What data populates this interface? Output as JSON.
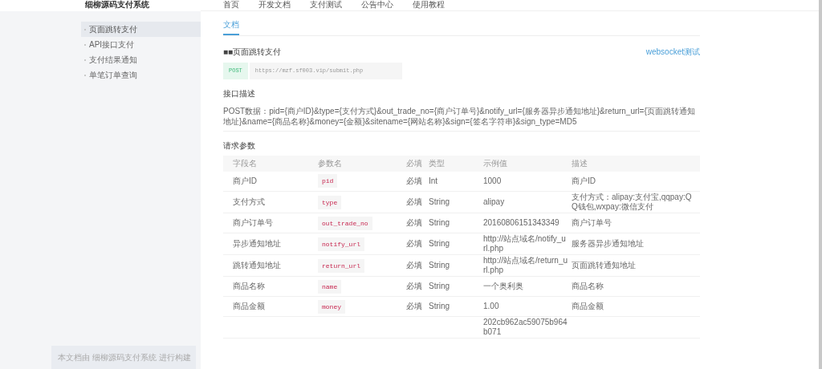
{
  "header": {
    "site_title": "细柳源码支付系统",
    "nav": [
      {
        "label": "首页"
      },
      {
        "label": "开发文档"
      },
      {
        "label": "支付测试"
      },
      {
        "label": "公告中心"
      },
      {
        "label": "使用教程"
      }
    ]
  },
  "sidebar": {
    "items": [
      {
        "label": "页面跳转支付",
        "selected": true
      },
      {
        "label": "API接口支付",
        "selected": false
      },
      {
        "label": "支付结果通知",
        "selected": false
      },
      {
        "label": "单笔订单查询",
        "selected": false
      }
    ],
    "footer": "本文档由 细柳源码支付系统 进行构建"
  },
  "tabs": [
    {
      "label": "文档",
      "selected": true
    }
  ],
  "section_title": "页面跳转支付",
  "section_prefix": "■■",
  "link": "websocket测试",
  "endpoint": {
    "method": "POST",
    "url": "https://mzf.sf003.vip/submit.php"
  },
  "description_title": "接口描述",
  "description": "POST数据：pid={商户ID}&type={支付方式}&out_trade_no={商户订单号}&notify_url={服务器异步通知地址}&return_url={页面跳转通知地址}&name={商品名称}&money={金额}&sitename={网站名称}&sign={签名字符串}&sign_type=MD5",
  "params_title": "请求参数",
  "table": {
    "columns": [
      "字段名",
      "参数名",
      "必填",
      "类型",
      "示例值",
      "描述"
    ],
    "rows": [
      {
        "field": "商户ID",
        "param": "pid",
        "required": "必填",
        "type": "Int",
        "example": "1000",
        "description": "商户ID"
      },
      {
        "field": "支付方式",
        "param": "type",
        "required": "必填",
        "type": "String",
        "example": "alipay",
        "description": "支付方式：alipay:支付宝,qqpay:QQ钱包,wxpay:微信支付"
      },
      {
        "field": "商户订单号",
        "param": "out_trade_no",
        "required": "必填",
        "type": "String",
        "example": "20160806151343349",
        "description": "商户订单号"
      },
      {
        "field": "异步通知地址",
        "param": "notify_url",
        "required": "必填",
        "type": "String",
        "example": "http://站点域名/notify_url.php",
        "description": "服务器异步通知地址"
      },
      {
        "field": "跳转通知地址",
        "param": "return_url",
        "required": "必填",
        "type": "String",
        "example": "http://站点域名/return_url.php",
        "description": "页面跳转通知地址"
      },
      {
        "field": "商品名称",
        "param": "name",
        "required": "必填",
        "type": "String",
        "example": "一个奥利奥",
        "description": "商品名称"
      },
      {
        "field": "商品金额",
        "param": "money",
        "required": "必填",
        "type": "String",
        "example": "1.00",
        "description": "商品金额"
      },
      {
        "example": "202cb962ac59075b964b071"
      }
    ]
  }
}
